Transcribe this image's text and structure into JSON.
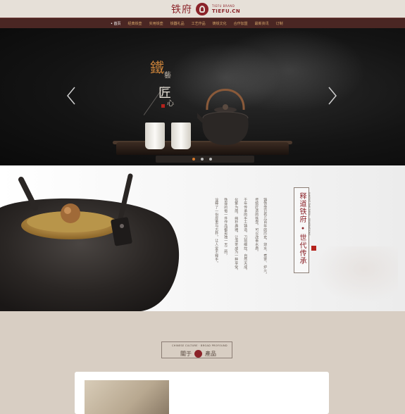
{
  "logo": {
    "cn": "铁府",
    "tagline": "TIEFU BRAND",
    "domain": "TIEFU.CN"
  },
  "nav": {
    "items": [
      "• 首页",
      "经典铁壶",
      "实用铁壶",
      "铁器礼品",
      "工艺作品",
      "铸铁文化",
      "合作加盟",
      "最新资讯",
      "订制"
    ]
  },
  "hero": {
    "chars": [
      "鐵",
      "藝",
      "匠",
      "心"
    ]
  },
  "feature": {
    "heading": "释道铁府 • 世代传承",
    "subtext": "INHERIT THE TIEFU · GENERATIONS",
    "paragraphs": [
      "铸铁壶已有几百年的历史，烧水、煮茶、炉火。",
      "传统匠造的铁壶，可以改善水质。",
      "千年传承的手工铸造，刀刻细纹，自然天成。",
      "化繁为简，纯朴典雅，让泡茶成为一种享受。",
      "铁壶的每一件作品都是独一无二的，",
      "诠释了一份厚重与古朴，让人爱不释手。"
    ]
  },
  "about": {
    "en": "CHINESE CULTURE · BROAD PROFOUND",
    "cn_left": "關于",
    "cn_right": "產品"
  }
}
